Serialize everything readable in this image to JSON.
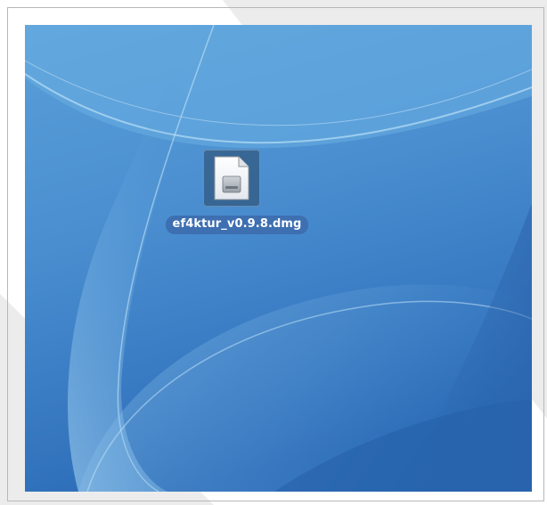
{
  "desktop": {
    "files": [
      {
        "name": "ef4ktur_v0.9.8.dmg",
        "icon": "disk-image-icon",
        "selected": true
      }
    ]
  },
  "colors": {
    "wallpaper_base": "#4a90cf",
    "wallpaper_dark": "#2f6fb8",
    "wallpaper_light": "#8cc4ea",
    "label_highlight": "#3d6fb1",
    "label_text": "#ffffff",
    "frame_border": "#b8b8b8"
  }
}
